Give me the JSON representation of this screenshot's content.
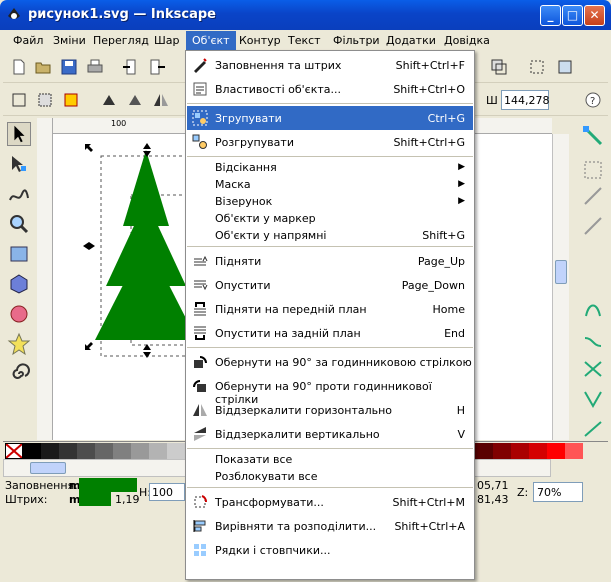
{
  "window": {
    "title": "рисунок1.svg — Inkscape"
  },
  "menubar": [
    "Файл",
    "Зміни",
    "Перегляд",
    "Шар",
    "Об'єкт",
    "Контур",
    "Текст",
    "Фільтри",
    "Додатки",
    "Довідка"
  ],
  "toolbar2": {
    "w_label": "Ш",
    "w_value": "144,278"
  },
  "status": {
    "fill_label": "Заповнення:",
    "fill_short": "m",
    "stroke_label": "Штрих:",
    "stroke_short": "m",
    "stroke_width": "1,19",
    "h_label": "H:",
    "h_value": "100",
    "x_coord": "05,71",
    "y_coord": "81,43",
    "z_label": "Z:",
    "zoom": "70%"
  },
  "ruler": {
    "mark": "100"
  },
  "menu": [
    {
      "label": "Заповнення та штрих",
      "shortcut": "Shift+Ctrl+F",
      "icon": "fill-stroke-icon"
    },
    {
      "label": "Властивості об'єкта...",
      "shortcut": "Shift+Ctrl+O",
      "icon": "object-properties-icon"
    },
    {
      "sep": true
    },
    {
      "label": "Згрупувати",
      "shortcut": "Ctrl+G",
      "icon": "group-icon",
      "highlight": true
    },
    {
      "label": "Розгрупувати",
      "shortcut": "Shift+Ctrl+G",
      "icon": "ungroup-icon"
    },
    {
      "sep": true
    },
    {
      "label": "Відсікання",
      "submenu": true
    },
    {
      "label": "Маска",
      "submenu": true
    },
    {
      "label": "Візерунок",
      "submenu": true
    },
    {
      "label": "Об'єкти у маркер"
    },
    {
      "label": "Об'єкти у напрямні",
      "shortcut": "Shift+G"
    },
    {
      "sep": true
    },
    {
      "label": "Підняти",
      "shortcut": "Page_Up",
      "icon": "raise-icon"
    },
    {
      "label": "Опустити",
      "shortcut": "Page_Down",
      "icon": "lower-icon"
    },
    {
      "label": "Підняти на передній план",
      "shortcut": "Home",
      "icon": "raise-to-top-icon"
    },
    {
      "label": "Опустити на задній план",
      "shortcut": "End",
      "icon": "lower-to-bottom-icon"
    },
    {
      "sep": true
    },
    {
      "label": "Обернути на 90° за годинниковою стрілкою",
      "icon": "rotate-cw-icon"
    },
    {
      "label": "Обернути на 90° проти годинникової стрілки",
      "icon": "rotate-ccw-icon"
    },
    {
      "label": "Віддзеркалити горизонтально",
      "shortcut": "H",
      "icon": "flip-horizontal-icon"
    },
    {
      "label": "Віддзеркалити вертикально",
      "shortcut": "V",
      "icon": "flip-vertical-icon"
    },
    {
      "sep": true
    },
    {
      "label": "Показати все"
    },
    {
      "label": "Розблокувати все"
    },
    {
      "sep": true
    },
    {
      "label": "Трансформувати...",
      "shortcut": "Shift+Ctrl+M",
      "icon": "transform-icon"
    },
    {
      "label": "Вирівняти та розподілити...",
      "shortcut": "Shift+Ctrl+A",
      "icon": "align-icon"
    },
    {
      "label": "Рядки і стовпчики...",
      "icon": "rows-columns-icon"
    }
  ]
}
